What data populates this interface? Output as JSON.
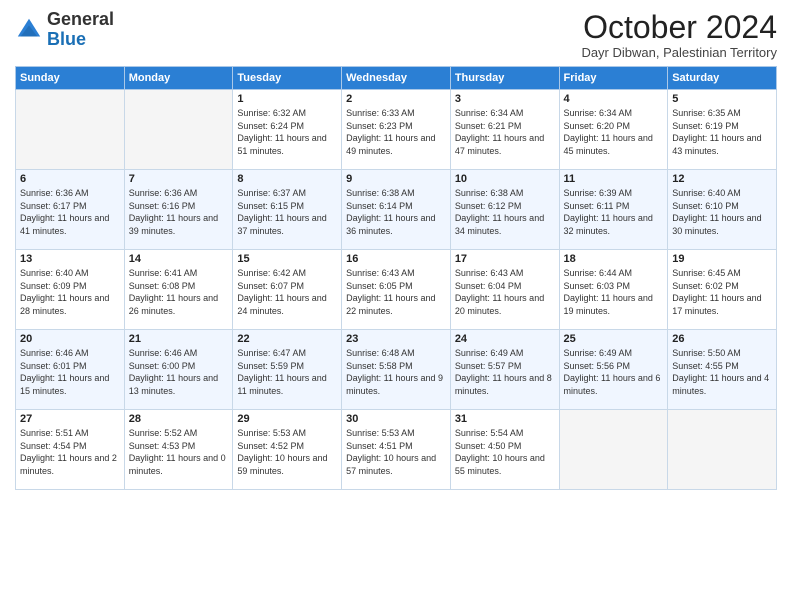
{
  "logo": {
    "general": "General",
    "blue": "Blue"
  },
  "header": {
    "month": "October 2024",
    "location": "Dayr Dibwan, Palestinian Territory"
  },
  "weekdays": [
    "Sunday",
    "Monday",
    "Tuesday",
    "Wednesday",
    "Thursday",
    "Friday",
    "Saturday"
  ],
  "weeks": [
    [
      {
        "day": "",
        "info": ""
      },
      {
        "day": "",
        "info": ""
      },
      {
        "day": "1",
        "info": "Sunrise: 6:32 AM\nSunset: 6:24 PM\nDaylight: 11 hours and 51 minutes."
      },
      {
        "day": "2",
        "info": "Sunrise: 6:33 AM\nSunset: 6:23 PM\nDaylight: 11 hours and 49 minutes."
      },
      {
        "day": "3",
        "info": "Sunrise: 6:34 AM\nSunset: 6:21 PM\nDaylight: 11 hours and 47 minutes."
      },
      {
        "day": "4",
        "info": "Sunrise: 6:34 AM\nSunset: 6:20 PM\nDaylight: 11 hours and 45 minutes."
      },
      {
        "day": "5",
        "info": "Sunrise: 6:35 AM\nSunset: 6:19 PM\nDaylight: 11 hours and 43 minutes."
      }
    ],
    [
      {
        "day": "6",
        "info": "Sunrise: 6:36 AM\nSunset: 6:17 PM\nDaylight: 11 hours and 41 minutes."
      },
      {
        "day": "7",
        "info": "Sunrise: 6:36 AM\nSunset: 6:16 PM\nDaylight: 11 hours and 39 minutes."
      },
      {
        "day": "8",
        "info": "Sunrise: 6:37 AM\nSunset: 6:15 PM\nDaylight: 11 hours and 37 minutes."
      },
      {
        "day": "9",
        "info": "Sunrise: 6:38 AM\nSunset: 6:14 PM\nDaylight: 11 hours and 36 minutes."
      },
      {
        "day": "10",
        "info": "Sunrise: 6:38 AM\nSunset: 6:12 PM\nDaylight: 11 hours and 34 minutes."
      },
      {
        "day": "11",
        "info": "Sunrise: 6:39 AM\nSunset: 6:11 PM\nDaylight: 11 hours and 32 minutes."
      },
      {
        "day": "12",
        "info": "Sunrise: 6:40 AM\nSunset: 6:10 PM\nDaylight: 11 hours and 30 minutes."
      }
    ],
    [
      {
        "day": "13",
        "info": "Sunrise: 6:40 AM\nSunset: 6:09 PM\nDaylight: 11 hours and 28 minutes."
      },
      {
        "day": "14",
        "info": "Sunrise: 6:41 AM\nSunset: 6:08 PM\nDaylight: 11 hours and 26 minutes."
      },
      {
        "day": "15",
        "info": "Sunrise: 6:42 AM\nSunset: 6:07 PM\nDaylight: 11 hours and 24 minutes."
      },
      {
        "day": "16",
        "info": "Sunrise: 6:43 AM\nSunset: 6:05 PM\nDaylight: 11 hours and 22 minutes."
      },
      {
        "day": "17",
        "info": "Sunrise: 6:43 AM\nSunset: 6:04 PM\nDaylight: 11 hours and 20 minutes."
      },
      {
        "day": "18",
        "info": "Sunrise: 6:44 AM\nSunset: 6:03 PM\nDaylight: 11 hours and 19 minutes."
      },
      {
        "day": "19",
        "info": "Sunrise: 6:45 AM\nSunset: 6:02 PM\nDaylight: 11 hours and 17 minutes."
      }
    ],
    [
      {
        "day": "20",
        "info": "Sunrise: 6:46 AM\nSunset: 6:01 PM\nDaylight: 11 hours and 15 minutes."
      },
      {
        "day": "21",
        "info": "Sunrise: 6:46 AM\nSunset: 6:00 PM\nDaylight: 11 hours and 13 minutes."
      },
      {
        "day": "22",
        "info": "Sunrise: 6:47 AM\nSunset: 5:59 PM\nDaylight: 11 hours and 11 minutes."
      },
      {
        "day": "23",
        "info": "Sunrise: 6:48 AM\nSunset: 5:58 PM\nDaylight: 11 hours and 9 minutes."
      },
      {
        "day": "24",
        "info": "Sunrise: 6:49 AM\nSunset: 5:57 PM\nDaylight: 11 hours and 8 minutes."
      },
      {
        "day": "25",
        "info": "Sunrise: 6:49 AM\nSunset: 5:56 PM\nDaylight: 11 hours and 6 minutes."
      },
      {
        "day": "26",
        "info": "Sunrise: 5:50 AM\nSunset: 4:55 PM\nDaylight: 11 hours and 4 minutes."
      }
    ],
    [
      {
        "day": "27",
        "info": "Sunrise: 5:51 AM\nSunset: 4:54 PM\nDaylight: 11 hours and 2 minutes."
      },
      {
        "day": "28",
        "info": "Sunrise: 5:52 AM\nSunset: 4:53 PM\nDaylight: 11 hours and 0 minutes."
      },
      {
        "day": "29",
        "info": "Sunrise: 5:53 AM\nSunset: 4:52 PM\nDaylight: 10 hours and 59 minutes."
      },
      {
        "day": "30",
        "info": "Sunrise: 5:53 AM\nSunset: 4:51 PM\nDaylight: 10 hours and 57 minutes."
      },
      {
        "day": "31",
        "info": "Sunrise: 5:54 AM\nSunset: 4:50 PM\nDaylight: 10 hours and 55 minutes."
      },
      {
        "day": "",
        "info": ""
      },
      {
        "day": "",
        "info": ""
      }
    ]
  ]
}
